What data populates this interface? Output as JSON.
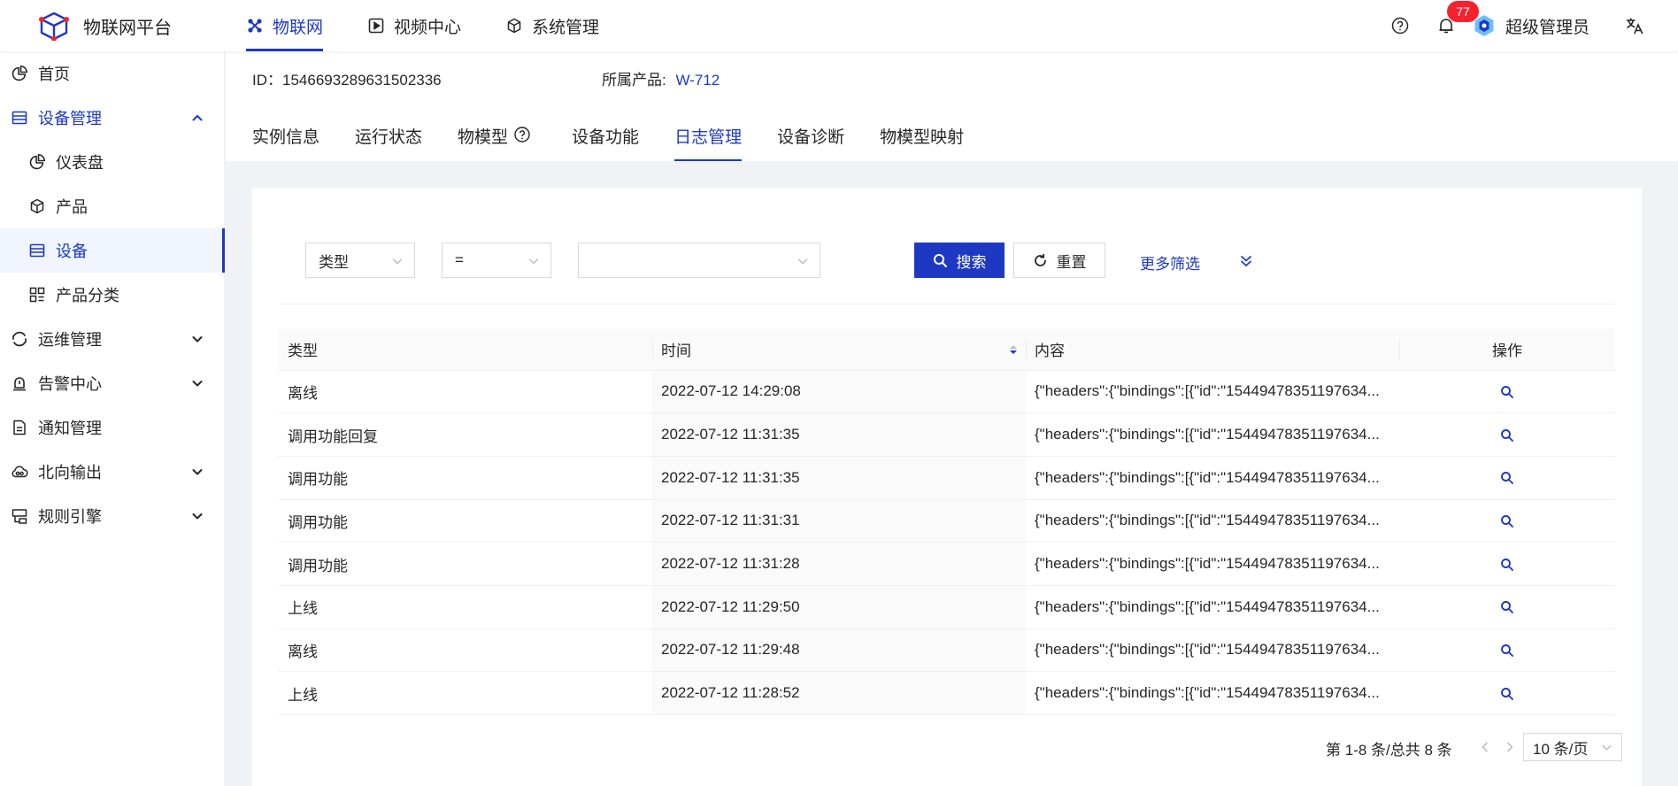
{
  "app": {
    "title": "物联网平台"
  },
  "topnav": [
    {
      "label": "物联网",
      "icon": "iot-icon",
      "active": true
    },
    {
      "label": "视频中心",
      "icon": "video-icon",
      "active": false
    },
    {
      "label": "系统管理",
      "icon": "cube-icon",
      "active": false
    }
  ],
  "header": {
    "notification_count": "77",
    "user_name": "超级管理员"
  },
  "sidebar": {
    "items": [
      {
        "label": "首页",
        "icon": "pie-icon"
      },
      {
        "label": "设备管理",
        "icon": "device-list-icon",
        "expanded": true
      },
      {
        "label": "仪表盘",
        "icon": "dashboard-icon"
      },
      {
        "label": "产品",
        "icon": "box-icon"
      },
      {
        "label": "设备",
        "icon": "device-icon",
        "selected": true
      },
      {
        "label": "产品分类",
        "icon": "category-icon"
      },
      {
        "label": "运维管理",
        "icon": "ops-icon"
      },
      {
        "label": "告警中心",
        "icon": "alarm-icon"
      },
      {
        "label": "通知管理",
        "icon": "notice-icon"
      },
      {
        "label": "北向输出",
        "icon": "cloud-icon"
      },
      {
        "label": "规则引擎",
        "icon": "rule-icon"
      }
    ]
  },
  "device": {
    "id_text": "ID：1546693289631502336",
    "product_label": "所属产品:",
    "product_value": "W-712"
  },
  "tabs": [
    {
      "label": "实例信息"
    },
    {
      "label": "运行状态"
    },
    {
      "label": "物模型",
      "help": true
    },
    {
      "label": "设备功能"
    },
    {
      "label": "日志管理",
      "active": true
    },
    {
      "label": "设备诊断"
    },
    {
      "label": "物模型映射"
    }
  ],
  "filter": {
    "field": "类型",
    "operator": "=",
    "value": "",
    "search_label": "搜索",
    "reset_label": "重置",
    "more_label": "更多筛选"
  },
  "table": {
    "columns": [
      "类型",
      "时间",
      "内容",
      "操作"
    ],
    "rows": [
      {
        "type": "离线",
        "time": "2022-07-12 14:29:08",
        "content": "{\"headers\":{\"bindings\":[{\"id\":\"15449478351197634..."
      },
      {
        "type": "调用功能回复",
        "time": "2022-07-12 11:31:35",
        "content": "{\"headers\":{\"bindings\":[{\"id\":\"15449478351197634..."
      },
      {
        "type": "调用功能",
        "time": "2022-07-12 11:31:35",
        "content": "{\"headers\":{\"bindings\":[{\"id\":\"15449478351197634..."
      },
      {
        "type": "调用功能",
        "time": "2022-07-12 11:31:31",
        "content": "{\"headers\":{\"bindings\":[{\"id\":\"15449478351197634..."
      },
      {
        "type": "调用功能",
        "time": "2022-07-12 11:31:28",
        "content": "{\"headers\":{\"bindings\":[{\"id\":\"15449478351197634..."
      },
      {
        "type": "上线",
        "time": "2022-07-12 11:29:50",
        "content": "{\"headers\":{\"bindings\":[{\"id\":\"15449478351197634..."
      },
      {
        "type": "离线",
        "time": "2022-07-12 11:29:48",
        "content": "{\"headers\":{\"bindings\":[{\"id\":\"15449478351197634..."
      },
      {
        "type": "上线",
        "time": "2022-07-12 11:28:52",
        "content": "{\"headers\":{\"bindings\":[{\"id\":\"15449478351197634..."
      }
    ]
  },
  "pagination": {
    "total_text": "第 1-8 条/总共 8 条",
    "page_size": "10 条/页"
  },
  "colors": {
    "primary": "#1d39c4",
    "badge": "#f5222d",
    "background": "#f0f2f5"
  }
}
